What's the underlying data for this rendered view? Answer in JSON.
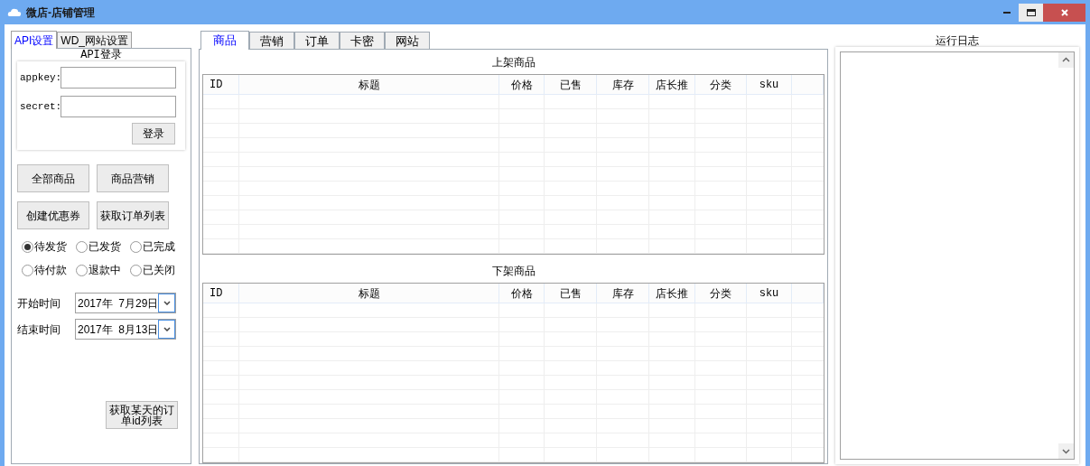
{
  "window": {
    "title": "微店-店铺管理"
  },
  "left_tabs": [
    {
      "label": "API设置",
      "selected": true
    },
    {
      "label": "WD_网站设置",
      "selected": false
    }
  ],
  "api_login": {
    "title": "API登录",
    "fields": [
      {
        "label": "appkey:"
      },
      {
        "label": "secret:"
      }
    ],
    "login_button": "登录"
  },
  "buttons": [
    "全部商品",
    "商品营销",
    "创建优惠券",
    "获取订单列表"
  ],
  "order_status": [
    {
      "label": "待发货",
      "selected": true
    },
    {
      "label": "已发货",
      "selected": false
    },
    {
      "label": "已完成",
      "selected": false
    },
    {
      "label": "待付款",
      "selected": false
    },
    {
      "label": "退款中",
      "selected": false
    },
    {
      "label": "已关闭",
      "selected": false
    }
  ],
  "dates": [
    {
      "label": "开始时间",
      "value": "2017年  7月29日"
    },
    {
      "label": "结束时间",
      "value": "2017年  8月13日"
    }
  ],
  "day_orders_button": "获取某天的订单id列表",
  "main_tabs": [
    {
      "label": "商品",
      "selected": true
    },
    {
      "label": "营销",
      "selected": false
    },
    {
      "label": "订单",
      "selected": false
    },
    {
      "label": "卡密",
      "selected": false
    },
    {
      "label": "网站",
      "selected": false
    }
  ],
  "tables": [
    {
      "title": "上架商品",
      "columns": [
        "ID",
        "标题",
        "价格",
        "已售",
        "库存",
        "店长推",
        "分类",
        "sku"
      ]
    },
    {
      "title": "下架商品",
      "columns": [
        "ID",
        "标题",
        "价格",
        "已售",
        "库存",
        "店长推",
        "分类",
        "sku"
      ]
    }
  ],
  "log": {
    "title": "运行日志"
  }
}
